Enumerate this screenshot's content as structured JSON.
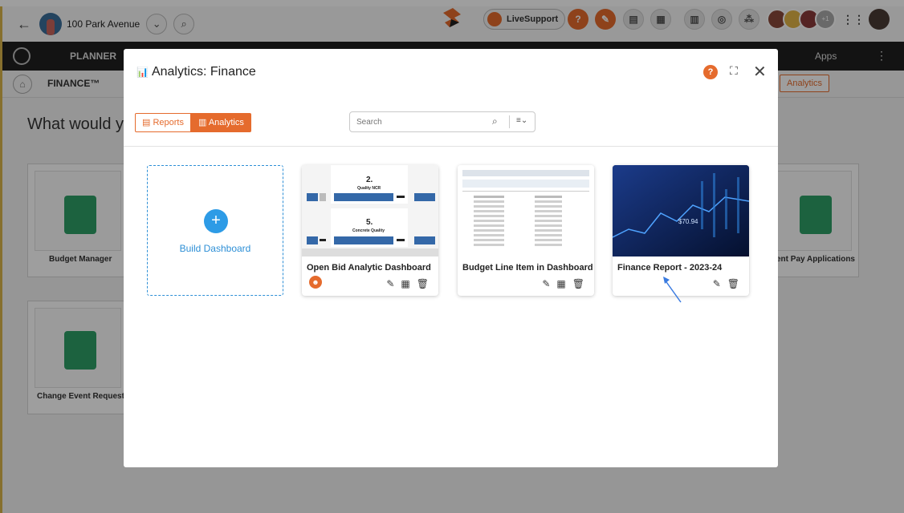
{
  "topbar": {
    "project_name": "100 Park Avenue",
    "live_support": "LiveSupport",
    "help_label": "?",
    "extra_count": "+1"
  },
  "darknav": {
    "module": "PLANNER",
    "apps": "Apps"
  },
  "subnav": {
    "module": "FINANCE™",
    "analytics": "Analytics"
  },
  "background": {
    "prompt": "What would yo",
    "tiles": [
      "Budget Manager",
      "Change Event Requests",
      "ent Pay Applications"
    ]
  },
  "modal": {
    "title": "Analytics: Finance",
    "help": "?",
    "tabs": {
      "reports": "Reports",
      "analytics": "Analytics"
    },
    "search_placeholder": "Search",
    "build_label": "Build Dashboard",
    "dashboards": [
      {
        "name": "Open Bid Analytic Dashboard",
        "thumb_labels": [
          "2.",
          "Quality NCR",
          "5.",
          "Concrete Quality"
        ]
      },
      {
        "name": "Budget Line Item in Dashboard"
      },
      {
        "name": "Finance Report - 2023-24",
        "thumb_value": "$70.94"
      }
    ]
  },
  "colors": {
    "accent": "#e56b2d",
    "link": "#2d8fd6",
    "green": "#2e9e66"
  }
}
